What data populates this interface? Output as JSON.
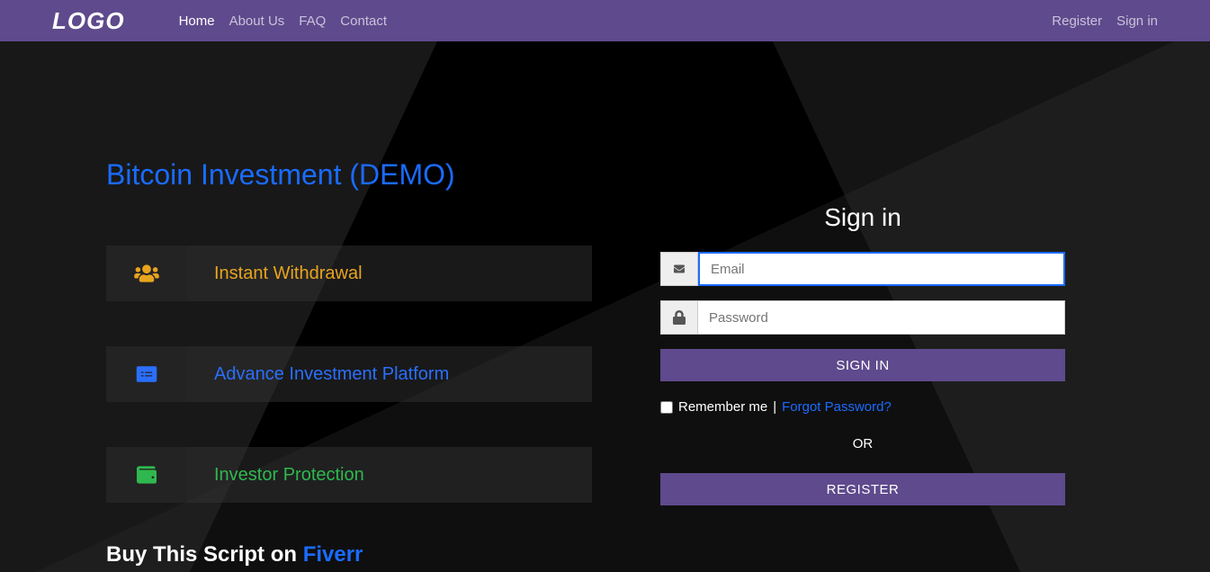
{
  "brand": "LOGO",
  "nav": {
    "links": [
      {
        "label": "Home",
        "active": true
      },
      {
        "label": "About Us",
        "active": false
      },
      {
        "label": "FAQ",
        "active": false
      },
      {
        "label": "Contact",
        "active": false
      }
    ],
    "right": [
      {
        "label": "Register"
      },
      {
        "label": "Sign in"
      }
    ]
  },
  "hero": {
    "title": "Bitcoin Investment (DEMO)",
    "features": [
      {
        "icon": "users-icon",
        "label": "Instant Withdrawal",
        "color": "c-yellow"
      },
      {
        "icon": "money-check-icon",
        "label": "Advance Investment Platform",
        "color": "c-blue"
      },
      {
        "icon": "wallet-icon",
        "label": "Investor Protection",
        "color": "c-green"
      }
    ]
  },
  "signin": {
    "title": "Sign in",
    "email_placeholder": "Email",
    "password_placeholder": "Password",
    "signin_btn": "SIGN IN",
    "remember_label": "Remember me",
    "separator_pipe": " | ",
    "forgot_label": "Forgot Password?",
    "or_label": "OR",
    "register_btn": "REGISTER"
  },
  "footer": {
    "buy_prefix": "Buy This Script on ",
    "buy_link": "Fiverr"
  }
}
